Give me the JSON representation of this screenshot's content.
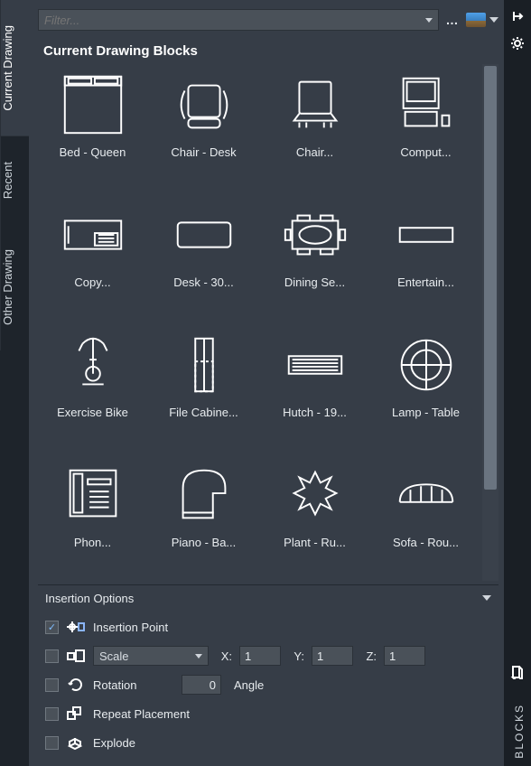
{
  "tabs": {
    "current": "Current Drawing",
    "recent": "Recent",
    "other": "Other Drawing"
  },
  "filter": {
    "placeholder": "Filter...",
    "value": ""
  },
  "section_title": "Current Drawing Blocks",
  "footer_label": "BLOCKS",
  "blocks": [
    {
      "label": "Bed - Queen"
    },
    {
      "label": "Chair - Desk"
    },
    {
      "label": "Chair..."
    },
    {
      "label": "Comput..."
    },
    {
      "label": "Copy..."
    },
    {
      "label": "Desk - 30..."
    },
    {
      "label": "Dining Se..."
    },
    {
      "label": "Entertain..."
    },
    {
      "label": "Exercise Bike"
    },
    {
      "label": "File Cabine..."
    },
    {
      "label": "Hutch - 19..."
    },
    {
      "label": "Lamp - Table"
    },
    {
      "label": "Phon..."
    },
    {
      "label": "Piano - Ba..."
    },
    {
      "label": "Plant - Ru..."
    },
    {
      "label": "Sofa - Rou..."
    }
  ],
  "options": {
    "header": "Insertion Options",
    "insertion_point": {
      "label": "Insertion Point",
      "checked": true
    },
    "scale": {
      "label": "Scale",
      "checked": false,
      "x": "1",
      "y": "1",
      "z": "1",
      "x_label": "X:",
      "y_label": "Y:",
      "z_label": "Z:"
    },
    "rotation": {
      "label": "Rotation",
      "checked": false,
      "value": "0",
      "angle_label": "Angle"
    },
    "repeat": {
      "label": "Repeat Placement",
      "checked": false
    },
    "explode": {
      "label": "Explode",
      "checked": false
    }
  }
}
